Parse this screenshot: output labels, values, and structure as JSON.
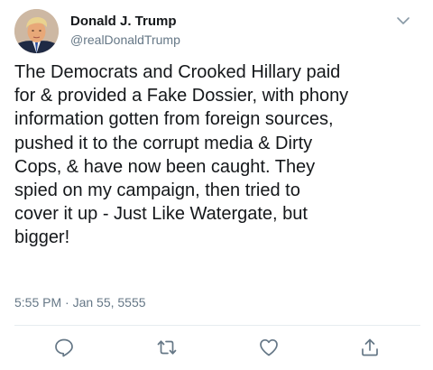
{
  "author": {
    "display_name": "Donald J. Trump",
    "handle": "@realDonaldTrump",
    "avatar_icon": "profile-photo"
  },
  "tweet": {
    "lines": [
      "The Democrats and Crooked Hillary paid",
      "for & provided a Fake Dossier, with phony",
      "information gotten from foreign sources,",
      "pushed it to the corrupt media & Dirty",
      "Cops, & have now been caught. They",
      "spied on my campaign, then tried to",
      "cover it up - Just Like Watergate, but",
      "bigger!"
    ],
    "timestamp": "5:55 PM · Jan 55, 5555"
  },
  "actions": [
    {
      "name": "reply",
      "icon": "speech-bubble-icon"
    },
    {
      "name": "retweet",
      "icon": "retweet-arrows-icon"
    },
    {
      "name": "like",
      "icon": "heart-icon"
    },
    {
      "name": "share",
      "icon": "share-upload-icon"
    }
  ],
  "colors": {
    "text": "#14171a",
    "secondary_text": "#657786",
    "divider": "#e6ecf0",
    "icon": "#657786"
  }
}
